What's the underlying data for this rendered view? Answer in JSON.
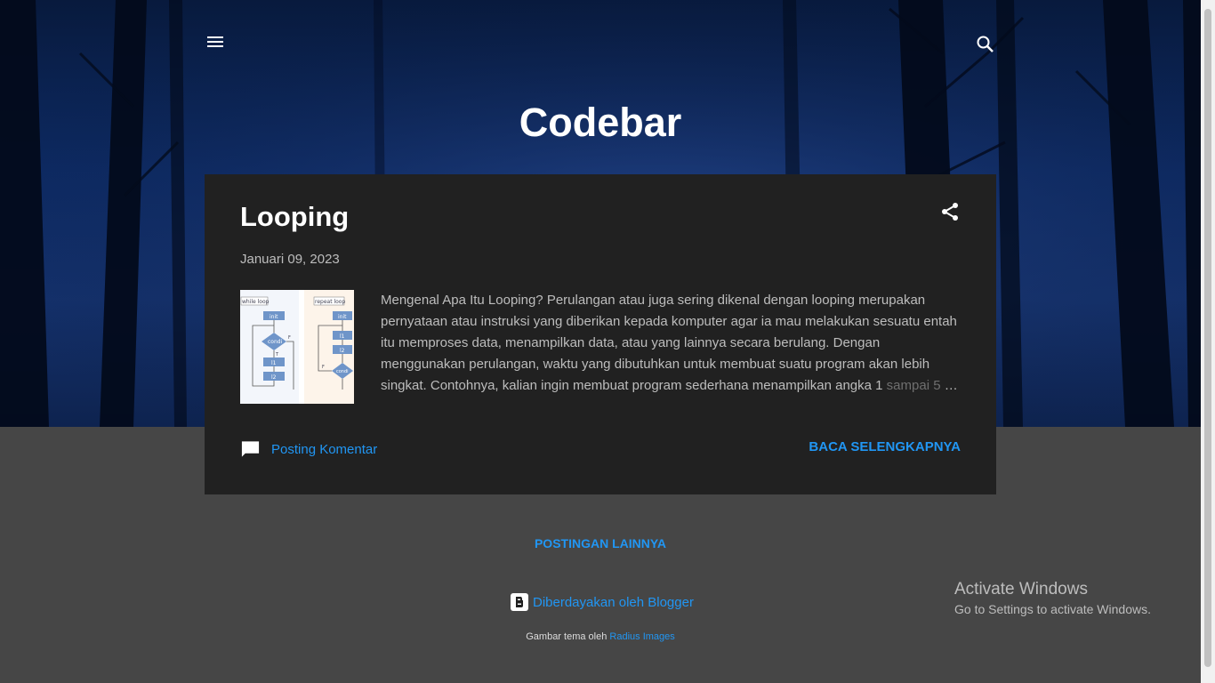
{
  "header": {
    "site_title": "Codebar",
    "menu_icon": "menu-icon",
    "search_icon": "search-icon"
  },
  "post": {
    "title": "Looping",
    "date": "Januari 09, 2023",
    "thumbnail": {
      "left_label": "while loop",
      "right_label": "repeat loop",
      "nodes": [
        "init",
        "condi",
        "l1",
        "l2",
        "T",
        "F"
      ]
    },
    "snippet_main": "  Mengenal Apa Itu Looping? Perulangan atau juga sering dikenal dengan looping merupakan pernyataan atau instruksi yang diberikan kepada komputer agar ia mau melakukan sesuatu entah itu memproses data, menampilkan data, atau yang lainnya secara berulang.  Dengan menggunakan perulangan, waktu yang dibutuhkan untuk membuat suatu program akan lebih singkat. Contohnya, kalian ingin membuat program sederhana menampilkan angka 1 ",
    "snippet_fade": "sampai 5",
    "snippet_ellipsis": " …",
    "comment_label": "Posting Komentar",
    "read_more_label": "BACA SELENGKAPNYA",
    "share_icon": "share-icon"
  },
  "footer": {
    "more_posts_label": "POSTINGAN LAINNYA",
    "powered_label": "Diberdayakan oleh Blogger",
    "attribution_prefix": "Gambar tema oleh ",
    "attribution_link": "Radius Images"
  },
  "overlay": {
    "activate_title": "Activate Windows",
    "activate_sub": "Go to Settings to activate Windows."
  },
  "colors": {
    "accent": "#2196f3",
    "card_bg": "#212121",
    "page_bg": "#464646"
  }
}
